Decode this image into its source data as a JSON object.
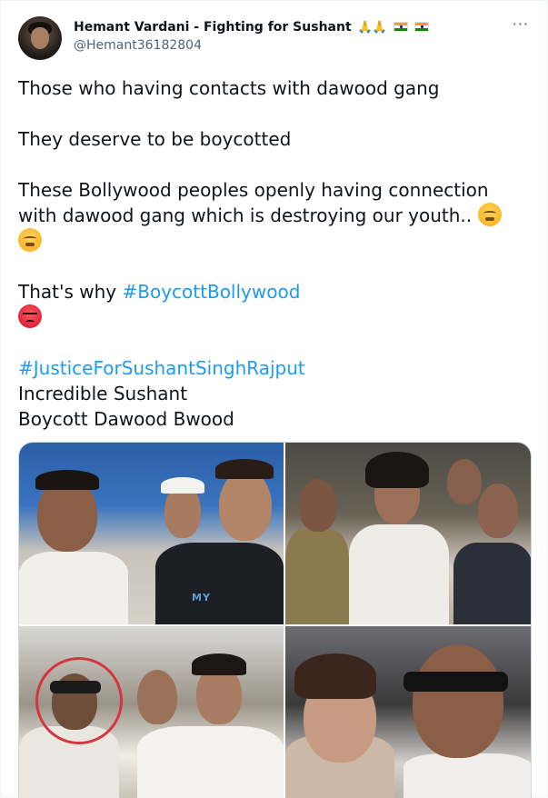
{
  "tweet": {
    "display_name": "Hemant Vardani - Fighting for Sushant",
    "name_emoji": "🙏🙏",
    "handle": "@Hemant36182804",
    "more_icon": "···",
    "lines": {
      "l1": "Those who having contacts with dawood gang",
      "l2": "They deserve to be boycotted",
      "l3": "These Bollywood peoples openly having connection",
      "l4": "with dawood gang which is destroying our youth..",
      "l5_prefix": "That's why ",
      "l5_hashtag": "#BoycottBollywood",
      "l6_hashtag": "#JusticeForSushantSinghRajput",
      "l7": "Incredible Sushant",
      "l8": "Boycott Dawood Bwood"
    },
    "icons": {
      "steam_emoji": "face-with-steam-icon",
      "angry_emoji": "pouting-face-icon",
      "flag": "india-flag-icon"
    },
    "media_caption_text": "MY"
  },
  "colors": {
    "hashtag": "#1d9bf0",
    "text": "#0f1419",
    "secondary": "#536471",
    "highlight_circle": "#d6343f"
  }
}
